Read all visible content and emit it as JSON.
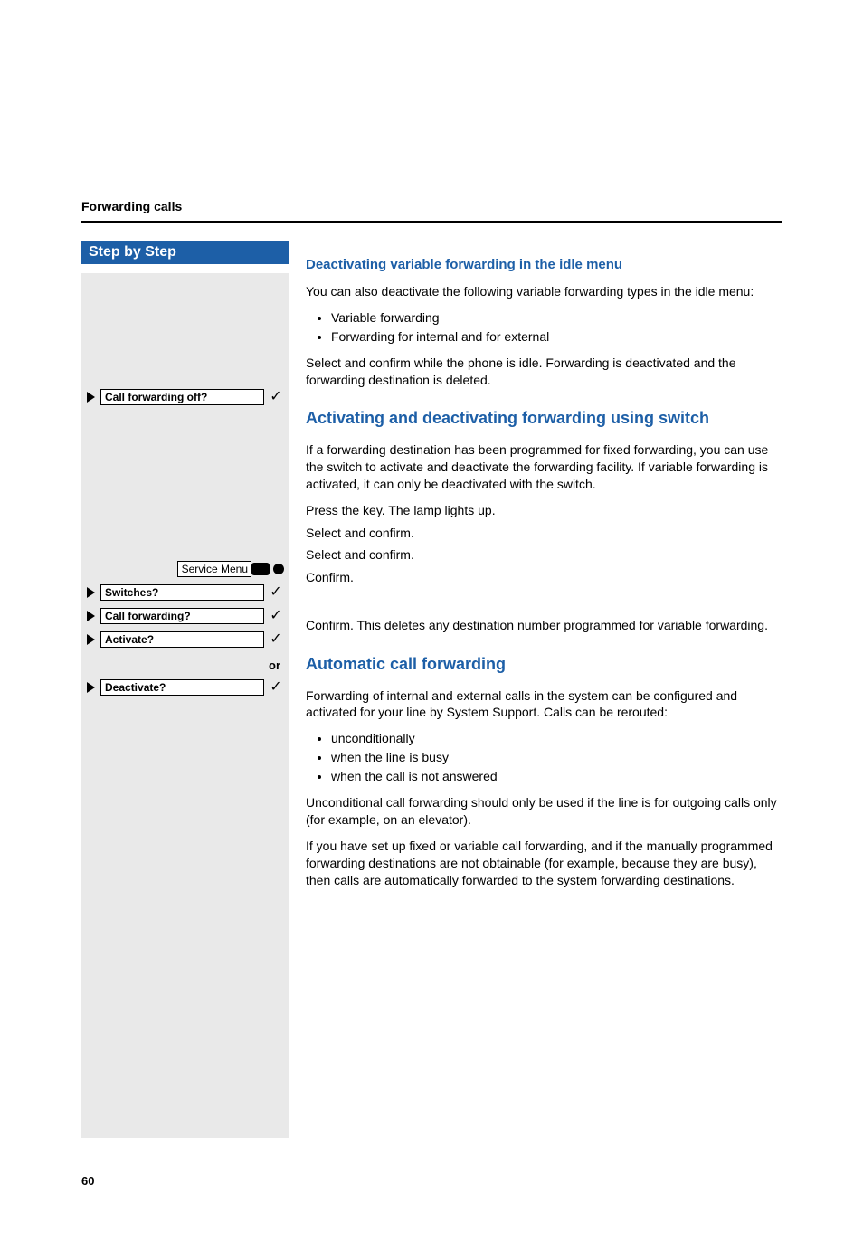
{
  "header": {
    "section_title": "Forwarding calls"
  },
  "sidebar": {
    "step_header": "Step by Step",
    "items": {
      "call_forwarding_off": "Call forwarding off?",
      "service_menu": "Service Menu",
      "switches": "Switches?",
      "call_forwarding": "Call forwarding?",
      "activate": "Activate?",
      "deactivate": "Deactivate?",
      "or_label": "or"
    }
  },
  "content": {
    "h_deactivate": "Deactivating variable forwarding in the idle menu",
    "p1": "You can also deactivate the following variable forwarding types in the idle menu:",
    "list1": [
      "Variable forwarding",
      "Forwarding for internal and for external"
    ],
    "p_select_idle": "Select and confirm while the phone is idle. Forwarding is deactivated and the forwarding destination is deleted.",
    "h_switch": "Activating and deactivating forwarding using switch",
    "p_switch_intro": "If a forwarding destination has been programmed for fixed forwarding, you can use the switch to activate and deactivate the forwarding facility. If variable forwarding is activated, it can only be deactivated with the switch.",
    "p_press_key": "Press the key. The lamp lights up.",
    "p_sel1": "Select and confirm.",
    "p_sel2": "Select and confirm.",
    "p_confirm": "Confirm.",
    "p_confirm_del": "Confirm. This deletes any destination number programmed for variable forwarding.",
    "h_auto": "Automatic call forwarding",
    "p_auto_intro": "Forwarding of internal and external calls in the system can be configured and activated for your line by System Support. Calls can be rerouted:",
    "list2": [
      "unconditionally",
      "when the line is busy",
      "when the call is not answered"
    ],
    "p_auto2": "Unconditional call forwarding should only be used if the line is for outgoing calls only (for example, on an elevator).",
    "p_auto3": "If you have set up fixed or variable call forwarding, and if the manually programmed forwarding destinations are not obtainable (for example, because they are busy), then calls are automatically forwarded to the system forwarding destinations."
  },
  "page_number": "60"
}
